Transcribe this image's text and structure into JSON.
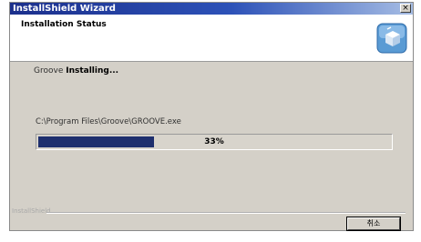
{
  "window": {
    "title": "InstallShield Wizard",
    "close_glyph": "×"
  },
  "header": {
    "title": "Installation Status",
    "icon": "installer-box-icon"
  },
  "status": {
    "product": "Groove",
    "action": "Installing..."
  },
  "file_path": "C:\\Program Files\\Groove\\GROOVE.exe",
  "progress": {
    "percent": 33,
    "label": "33%",
    "color": "#1e2f6e"
  },
  "footer": {
    "brand": "InstallShield"
  },
  "buttons": {
    "cancel_label": "취소"
  },
  "colors": {
    "titlebar": "#1b2f8c",
    "dialog_bg": "#d4d0c8"
  }
}
